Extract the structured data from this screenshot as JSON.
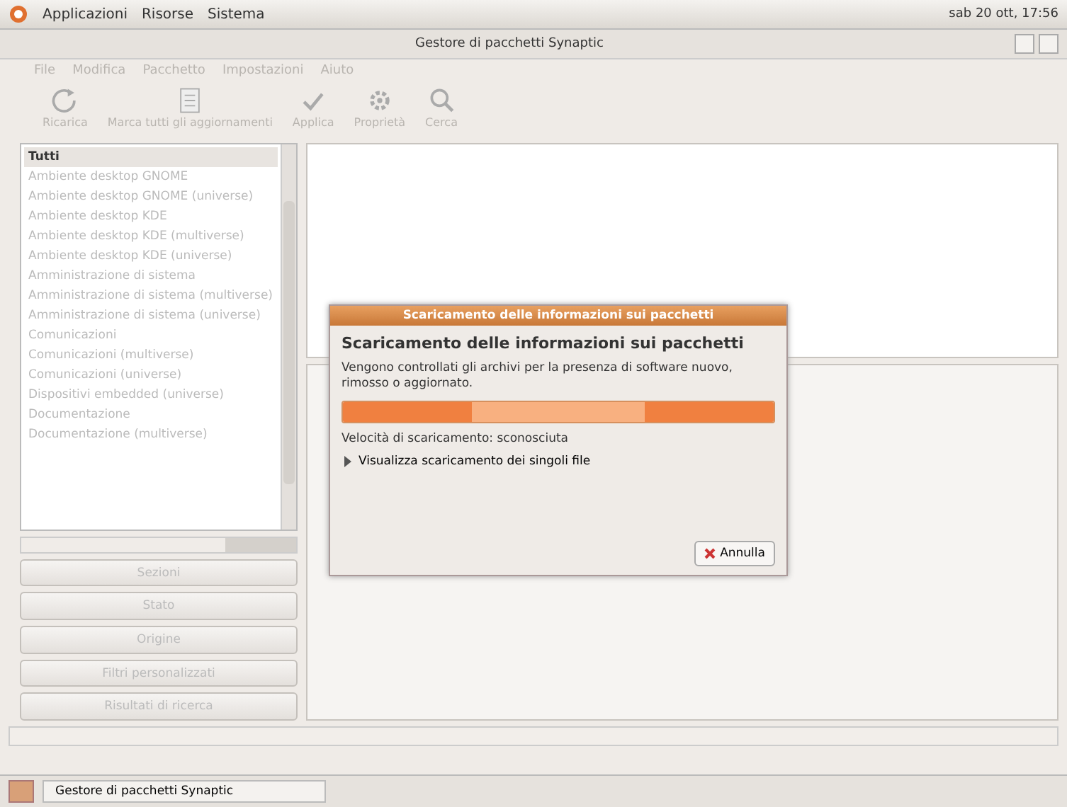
{
  "top_panel": {
    "menus": [
      "Applicazioni",
      "Risorse",
      "Sistema"
    ],
    "clock": "sab 20 ott, 17:56"
  },
  "window": {
    "title": "Gestore di pacchetti Synaptic"
  },
  "menu_bar": [
    {
      "label": "File",
      "disabled": true
    },
    {
      "label": "Modifica",
      "disabled": true
    },
    {
      "label": "Pacchetto",
      "disabled": true
    },
    {
      "label": "Impostazioni",
      "disabled": true
    },
    {
      "label": "Aiuto",
      "disabled": true
    }
  ],
  "toolbar": [
    {
      "label": "Ricarica",
      "disabled": true
    },
    {
      "label": "Marca tutti gli aggiornamenti",
      "disabled": true
    },
    {
      "label": "Applica",
      "disabled": true
    },
    {
      "label": "Proprietà",
      "disabled": true
    },
    {
      "label": "Cerca",
      "disabled": true
    }
  ],
  "sections": [
    {
      "label": "Tutti",
      "selected": true
    },
    {
      "label": "Ambiente desktop GNOME",
      "selected": false
    },
    {
      "label": "Ambiente desktop GNOME (universe)",
      "selected": false
    },
    {
      "label": "Ambiente desktop KDE",
      "selected": false
    },
    {
      "label": "Ambiente desktop KDE (multiverse)",
      "selected": false
    },
    {
      "label": "Ambiente desktop KDE (universe)",
      "selected": false
    },
    {
      "label": "Amministrazione di sistema",
      "selected": false
    },
    {
      "label": "Amministrazione di sistema (multiverse)",
      "selected": false
    },
    {
      "label": "Amministrazione di sistema (universe)",
      "selected": false
    },
    {
      "label": "Comunicazioni",
      "selected": false
    },
    {
      "label": "Comunicazioni (multiverse)",
      "selected": false
    },
    {
      "label": "Comunicazioni (universe)",
      "selected": false
    },
    {
      "label": "Dispositivi embedded (universe)",
      "selected": false
    },
    {
      "label": "Documentazione",
      "selected": false
    },
    {
      "label": "Documentazione (multiverse)",
      "selected": false
    }
  ],
  "filter_buttons": [
    "Sezioni",
    "Stato",
    "Origine",
    "Filtri personalizzati",
    "Risultati di ricerca"
  ],
  "dialog": {
    "title": "Scaricamento delle informazioni sui pacchetti",
    "heading": "Scaricamento delle informazioni sui pacchetti",
    "message": "Vengono controllati gli archivi per la presenza di software nuovo, rimosso o aggiornato.",
    "progress": {
      "level": 1
    },
    "speed": "Velocità di scaricamento: sconosciuta",
    "expander": {
      "label": "Visualizza scaricamento dei singoli file",
      "expanded": false
    },
    "cancel": "Annulla"
  },
  "taskbar": {
    "task": "Gestore di pacchetti Synaptic"
  }
}
